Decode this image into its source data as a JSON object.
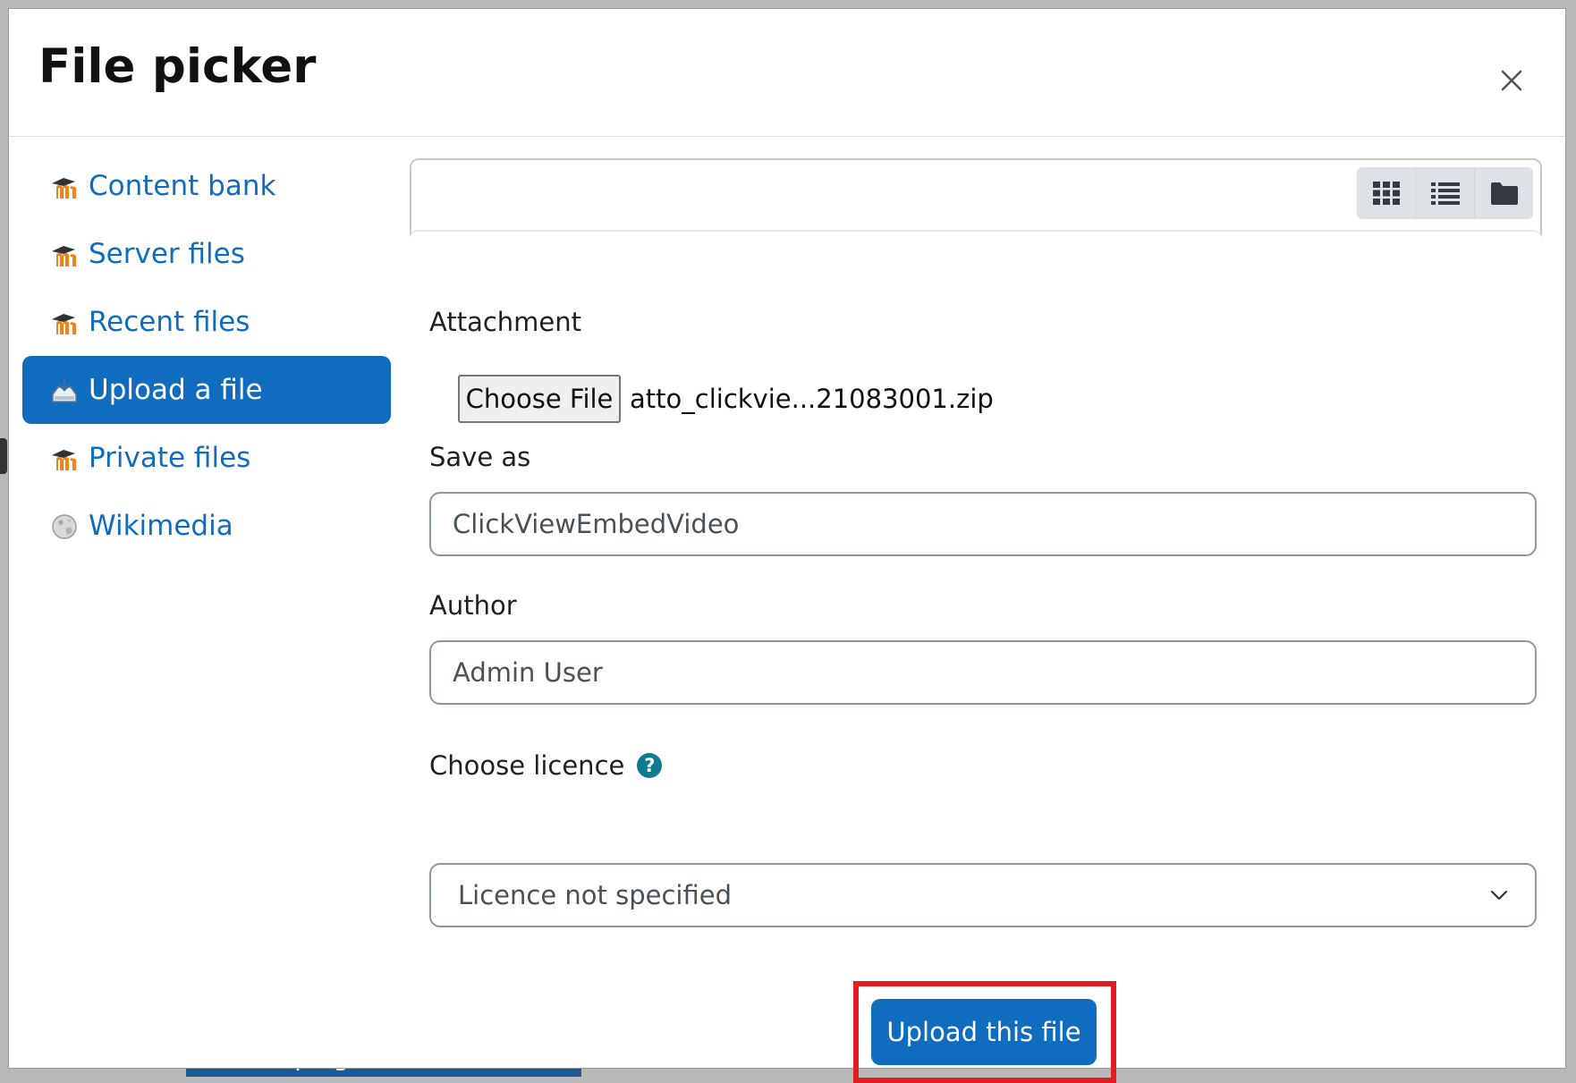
{
  "background": {
    "strip_text": "Install plugin from the ZIP file"
  },
  "dialog": {
    "title": "File picker",
    "close_icon": "close-icon"
  },
  "sidebar": {
    "items": [
      {
        "label": "Content bank",
        "icon": "moodle-icon",
        "active": false
      },
      {
        "label": "Server files",
        "icon": "moodle-icon",
        "active": false
      },
      {
        "label": "Recent files",
        "icon": "moodle-icon",
        "active": false
      },
      {
        "label": "Upload a file",
        "icon": "upload-icon",
        "active": true
      },
      {
        "label": "Private files",
        "icon": "moodle-icon",
        "active": false
      },
      {
        "label": "Wikimedia",
        "icon": "globe-icon",
        "active": false
      }
    ]
  },
  "toolbar": {
    "views": [
      {
        "name": "icons-view",
        "icon": "grid-icon"
      },
      {
        "name": "list-view",
        "icon": "list-icon"
      },
      {
        "name": "tree-view",
        "icon": "folder-icon"
      }
    ]
  },
  "form": {
    "attachment_label": "Attachment",
    "choose_file_label": "Choose File",
    "file_name": "atto_clickvie...21083001.zip",
    "save_as_label": "Save as",
    "save_as_value": "ClickViewEmbedVideo",
    "author_label": "Author",
    "author_value": "Admin User",
    "licence_label": "Choose licence",
    "licence_help": "?",
    "licence_value": "Licence not specified",
    "upload_button_label": "Upload this file"
  },
  "colors": {
    "primary": "#0f6cbf",
    "highlight": "#e31b23",
    "help": "#0f7a91"
  }
}
